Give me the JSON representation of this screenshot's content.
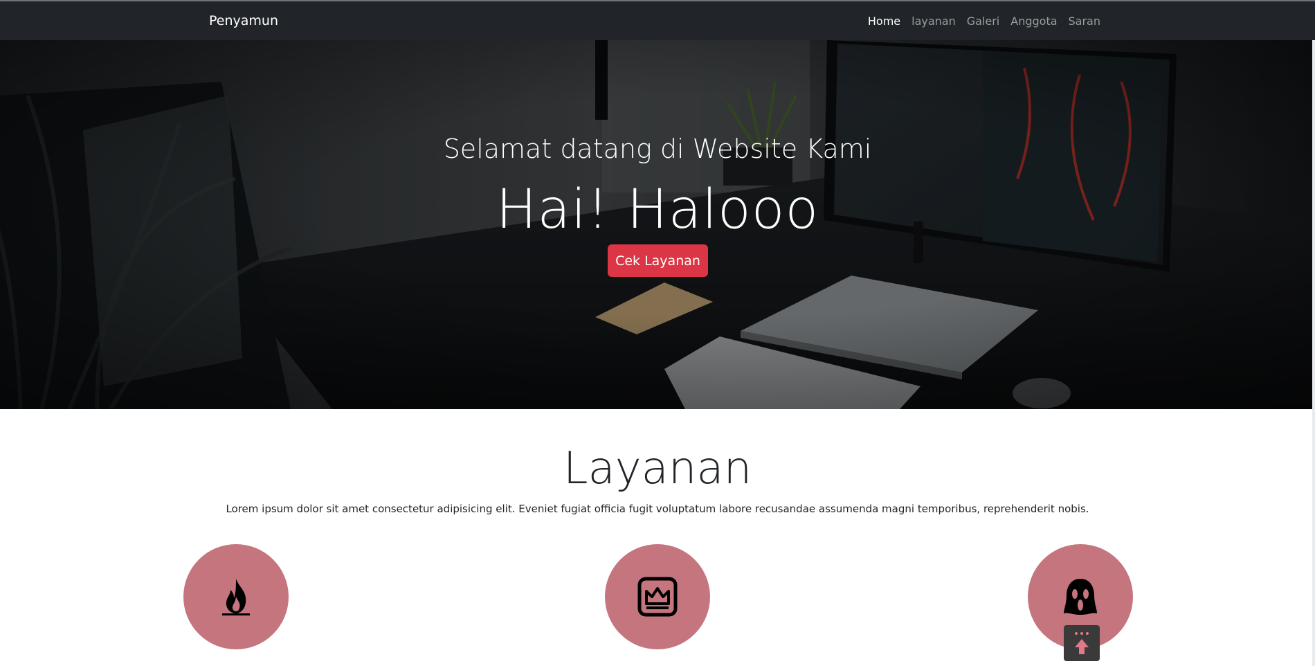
{
  "navbar": {
    "brand": "Penyamun",
    "links": [
      "Home",
      "layanan",
      "Galeri",
      "Anggota",
      "Saran"
    ],
    "active": "Home"
  },
  "hero": {
    "subtitle": "Selamat datang di Website Kami",
    "title": "Hai! Halooo",
    "button_label": "Cek Layanan",
    "button_color": "#dc3545"
  },
  "services": {
    "title": "Layanan",
    "description": "Lorem ipsum dolor sit amet consectetur adipisicing elit. Eveniet fugiat officia fugit voluptatum labore recusandae assumenda magni temporibus, reprehenderit nobis.",
    "circle_color": "#c5757d",
    "items": [
      {
        "icon": "fire-icon"
      },
      {
        "icon": "crown-icon"
      },
      {
        "icon": "ghost-mask-icon"
      }
    ]
  },
  "scroll_top": {
    "icon": "arrow-up-icon"
  },
  "colors": {
    "navbar_bg": "#212529",
    "accent": "#dc3545"
  }
}
